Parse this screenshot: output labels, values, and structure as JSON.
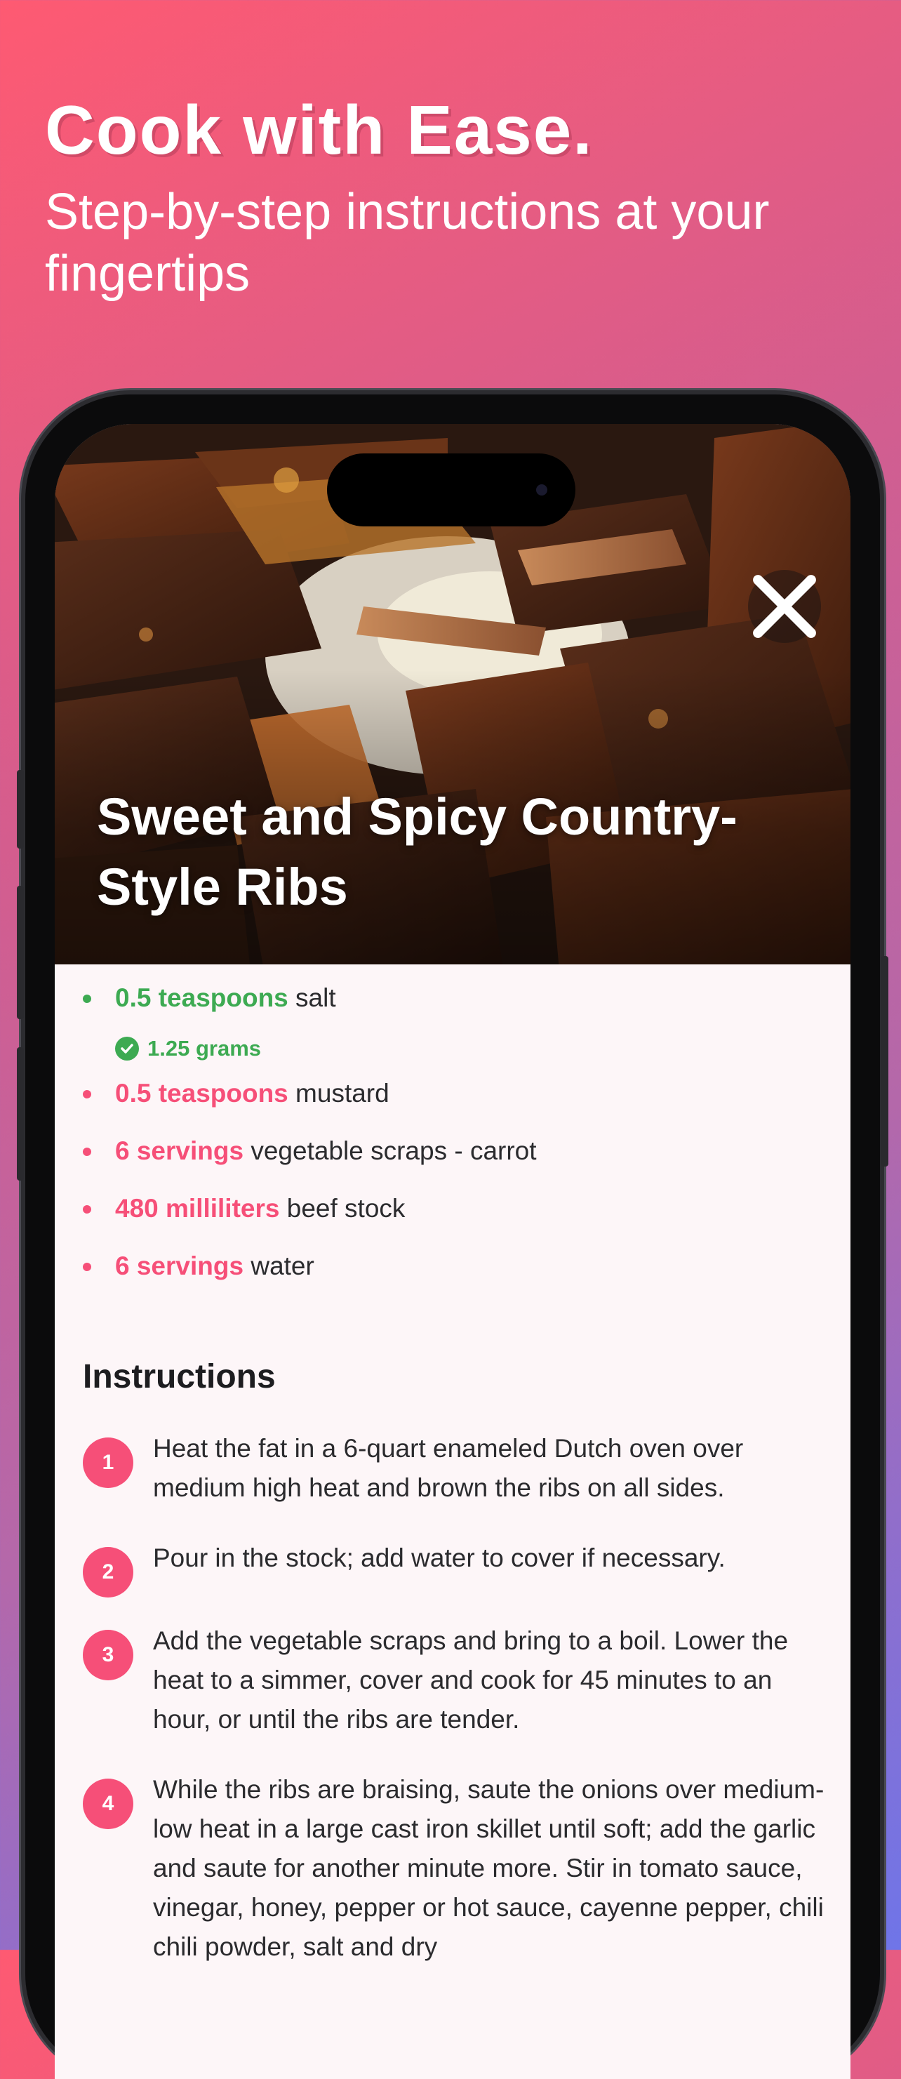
{
  "promo": {
    "headline": "Cook with Ease.",
    "subheadline": "Step-by-step instructions at your fingertips"
  },
  "recipe": {
    "title": "Sweet and Spicy Country-Style Ribs",
    "ingredients": [
      {
        "qty": "0.5 teaspoons",
        "name": " salt",
        "checked": true,
        "converted": "1.25 grams"
      },
      {
        "qty": "0.5 teaspoons",
        "name": " mustard",
        "checked": false
      },
      {
        "qty": "6 servings",
        "name": " vegetable scraps - carrot",
        "checked": false
      },
      {
        "qty": "480 milliliters",
        "name": " beef stock",
        "checked": false
      },
      {
        "qty": "6 servings",
        "name": " water",
        "checked": false
      }
    ],
    "instructions_heading": "Instructions",
    "steps": [
      {
        "number": "1",
        "text": "Heat the fat in a 6-quart enameled Dutch oven over medium high heat and brown the ribs on all sides."
      },
      {
        "number": "2",
        "text": "Pour in the stock; add water to cover if necessary."
      },
      {
        "number": "3",
        "text": "Add the vegetable scraps and bring to a boil.  Lower the heat to a simmer, cover and cook for 45 minutes to an hour, or until the ribs are tender."
      },
      {
        "number": "4",
        "text": "While the ribs are braising, saute the onions over medium-low heat in a large cast iron skillet until soft; add the garlic and saute for another minute more.  Stir in tomato sauce, vinegar, honey, pepper or hot sauce, cayenne pepper, chili chili powder, salt and dry"
      }
    ]
  },
  "icons": {
    "close": "close-icon",
    "check": "check-circle-icon"
  },
  "colors": {
    "accent_pink": "#f64f78",
    "checked_green": "#3daa52",
    "background_gradient_start": "#fe5a72",
    "background_gradient_end": "#6f75e8"
  }
}
